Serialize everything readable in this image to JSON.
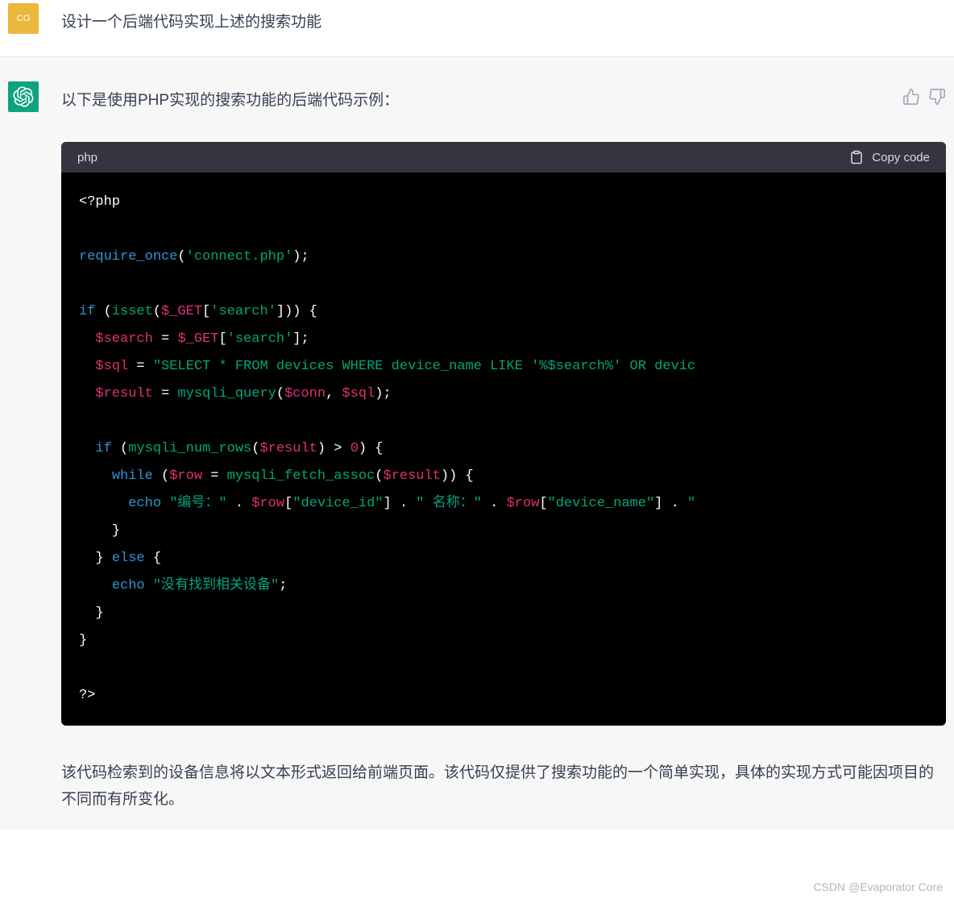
{
  "user": {
    "avatar_initials": "CO",
    "message": "设计一个后端代码实现上述的搜索功能"
  },
  "assistant": {
    "intro": "以下是使用PHP实现的搜索功能的后端代码示例：",
    "code_lang": "php",
    "copy_label": "Copy code",
    "explanation": "该代码检索到的设备信息将以文本形式返回给前端页面。该代码仅提供了搜索功能的一个简单实现，具体的实现方式可能因项目的不同而有所变化。",
    "code": {
      "connect_string": "'connect.php'",
      "get_search": "'search'",
      "sql_string": "\"SELECT * FROM devices WHERE device_name LIKE '%$search%' OR devic",
      "echo_prefix": "\"编号：\"",
      "device_id_key": "\"device_id\"",
      "name_label": "\" 名称：\"",
      "device_name_key": "\"device_name\"",
      "trail": "\"",
      "not_found": "\"没有找到相关设备\""
    }
  },
  "watermark": "CSDN @Evaporator Core"
}
